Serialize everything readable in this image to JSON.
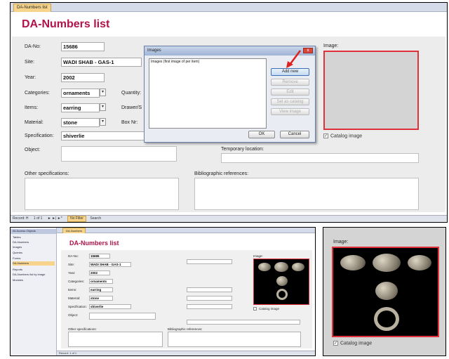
{
  "colors": {
    "accent_title": "#b0124a",
    "highlight_red": "#e0303a",
    "tab_orange": "#f6d48b",
    "arrow_red": "#e02020"
  },
  "main_form": {
    "tab_label": "DA-Numbers list",
    "title": "DA-Numbers list",
    "labels": {
      "da_no": "DA-No:",
      "site": "Site:",
      "year": "Year:",
      "categories": "Categories:",
      "items": "Items:",
      "material": "Material:",
      "quantity": "Quantity:",
      "drawer": "Drawer/S",
      "box": "Box Nr:",
      "specification": "Specification:",
      "object": "Object:",
      "temporary_location": "Temporary location:",
      "other_specifications": "Other specifications:",
      "bibliographic_references": "Bibliographic references:",
      "image": "Image:",
      "catalog_image": "Catalog image"
    },
    "values": {
      "da_no": "15686",
      "site": "WADI SHAB - GAS-1",
      "year": "2002",
      "categories": "ornaments",
      "items": "earring",
      "material": "stone",
      "specification": "shiverlie"
    },
    "record_nav": {
      "record_label": "Record: H",
      "position": "1 of 1",
      "filter_label": "No Filter",
      "search_label": "Search"
    }
  },
  "dialog": {
    "title": "Images",
    "list_header": "Images (first image of per item)",
    "buttons": {
      "add": "Add new",
      "remove": "Remove",
      "edit": "Edit",
      "set_catalog": "Set as catalog",
      "view_image": "View image",
      "ok": "OK",
      "cancel": "Cancel"
    },
    "close_glyph": "x"
  },
  "small_form": {
    "tab_label": "DA-Numbers",
    "title": "DA-Numbers list",
    "sidebar_items": [
      "All Access Objects",
      "Tables",
      "DA-Numbers",
      "Images",
      "Queries",
      "Forms",
      "DA-Numbers",
      "Reports",
      "DA-Numbers list by image",
      "Modules"
    ],
    "labels": [
      "DA-No:",
      "Site:",
      "Year:",
      "Categories:",
      "Items:",
      "Material:",
      "Specification:",
      "Object:",
      "Other specifications:",
      "Bibliographic references:",
      "Image:",
      "Catalog image"
    ],
    "values": [
      "15686",
      "WADI SHAB - GAS-1",
      "2002",
      "ornaments",
      "earring",
      "stone",
      "shiverlie"
    ],
    "record_nav": "Record: 1 of 1"
  },
  "zoom_panel": {
    "label": "Image:",
    "catalog_image": "Catalog image"
  }
}
